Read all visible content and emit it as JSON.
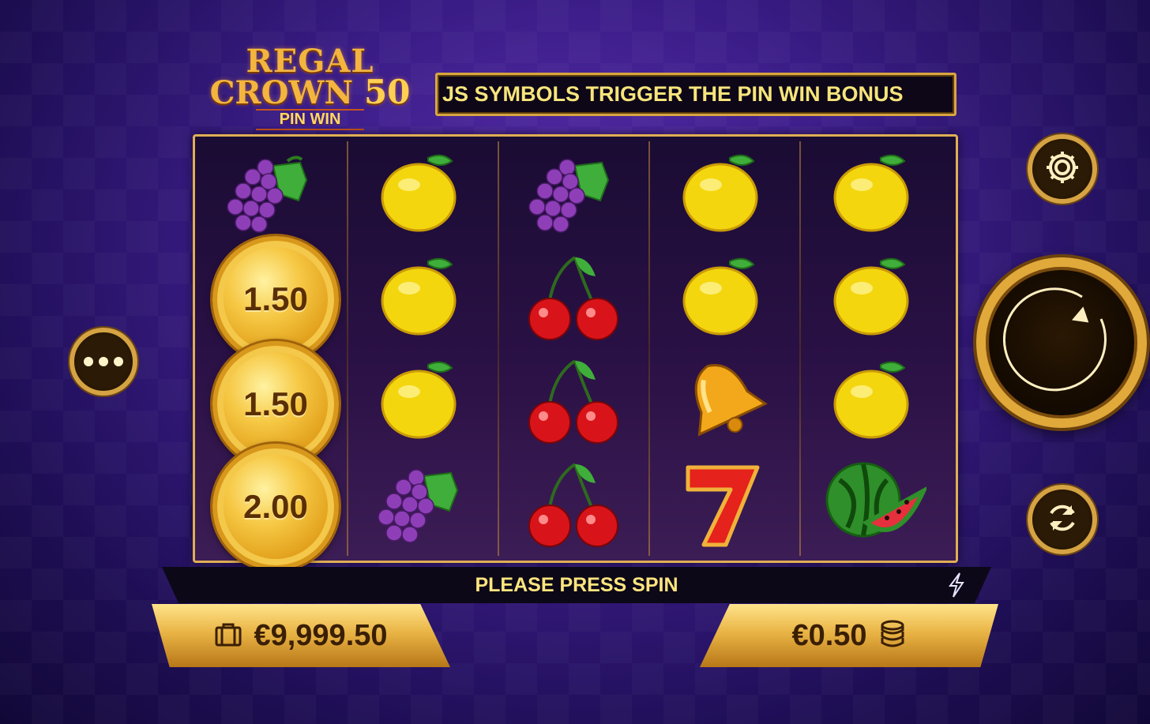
{
  "game": {
    "logo_line1": "REGAL",
    "logo_line2_word": "CROWN",
    "logo_line2_num": "50",
    "logo_sub": "PIN WIN"
  },
  "marquee": {
    "text": "JS SYMBOLS TRIGGER THE PIN WIN BONUS"
  },
  "reels": [
    [
      "grapes",
      "coin",
      "coin",
      "coin"
    ],
    [
      "lemon",
      "lemon",
      "lemon",
      "grapes"
    ],
    [
      "grapes",
      "cherries",
      "cherries",
      "cherries"
    ],
    [
      "lemon",
      "lemon",
      "bell",
      "seven"
    ],
    [
      "lemon",
      "lemon",
      "lemon",
      "watermelon"
    ]
  ],
  "coins": {
    "coin1": "1.50",
    "coin2": "1.50",
    "coin3": "2.00"
  },
  "status": {
    "message": "PLEASE PRESS SPIN"
  },
  "balance": {
    "value": "€9,999.50",
    "icon": "briefcase-icon"
  },
  "bet": {
    "value": "€0.50",
    "icon": "coin-stack-icon"
  },
  "colors": {
    "gold": "#e0ae55",
    "text_yellow": "#ffe57e",
    "background": "#3a1c86"
  }
}
